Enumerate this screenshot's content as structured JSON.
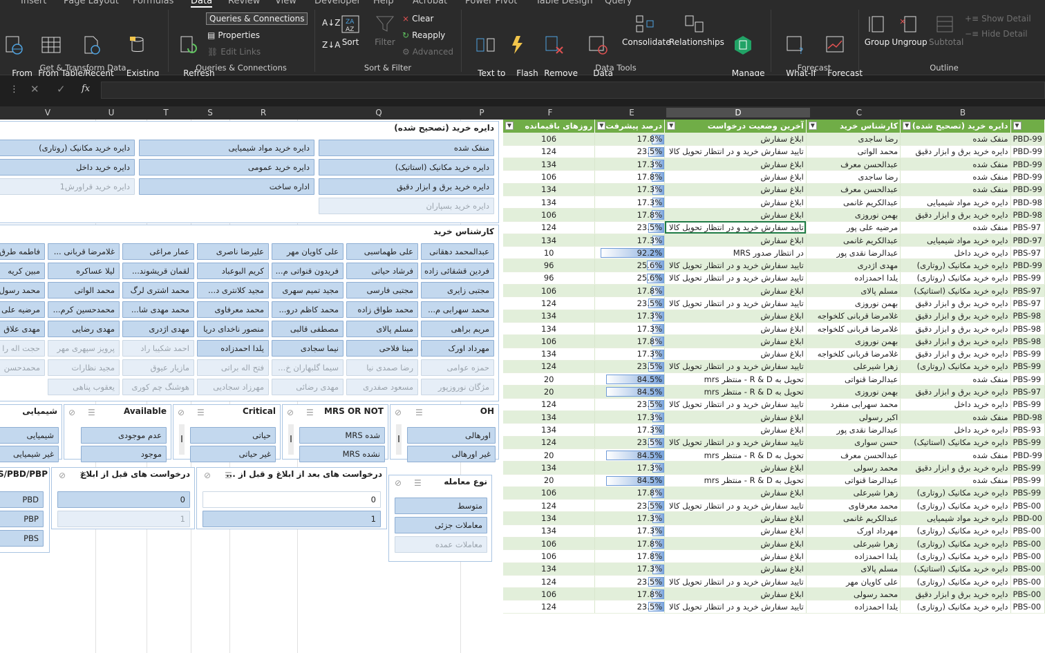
{
  "ribbon_tabs": [
    "Insert",
    "Page Layout",
    "Formulas",
    "Data",
    "Review",
    "View",
    "Developer",
    "Help",
    "Acrobat",
    "Power Pivot",
    "Table Design",
    "Query"
  ],
  "ribbon": {
    "get_transform": {
      "label": "Get & Transform Data",
      "from_web": "From\nWeb",
      "from_table": "From Table/\nRange",
      "recent_sources": "Recent\nSources",
      "existing_connections": "Existing\nConnections"
    },
    "queries": {
      "label": "Queries & Connections",
      "refresh_all": "Refresh\nAll",
      "queries_connections": "Queries & Connections",
      "properties": "Properties",
      "edit_links": "Edit Links"
    },
    "sort_filter": {
      "label": "Sort & Filter",
      "sort": "Sort",
      "filter": "Filter",
      "clear": "Clear",
      "reapply": "Reapply",
      "advanced": "Advanced"
    },
    "data_tools": {
      "label": "Data Tools",
      "text_to_columns": "Text to\nColumns",
      "flash_fill": "Flash\nFill",
      "remove_duplicates": "Remove\nDuplicates",
      "data_validation": "Data\nValidation",
      "consolidate": "Consolidate",
      "relationships": "Relationships",
      "manage_data_model": "Manage\nData Model"
    },
    "forecast": {
      "label": "Forecast",
      "what_if": "What-If\nAnalysis",
      "forecast_sheet": "Forecast\nSheet"
    },
    "outline": {
      "label": "Outline",
      "group": "Group",
      "ungroup": "Ungroup",
      "subtotal": "Subtotal",
      "show_detail": "Show Detail",
      "hide_detail": "Hide Detail"
    }
  },
  "formula_bar": {
    "fx": "fx",
    "value": ""
  },
  "columns_left": [
    "V",
    "U",
    "T",
    "S",
    "R",
    "Q",
    "P"
  ],
  "columns_right": [
    "F",
    "E",
    "D",
    "C",
    "B"
  ],
  "slicers": {
    "dayere": {
      "title": "دایره خرید (تصحیح شده)",
      "items": [
        {
          "label": "منفک شده",
          "on": true
        },
        {
          "label": "دایره خرید مواد شیمیایی",
          "on": true
        },
        {
          "label": "دایره خرید مکانیک (روتاری)",
          "on": true
        },
        {
          "label": "دایره خرید مکانیک (استاتیک)",
          "on": true
        },
        {
          "label": "دایره خرید عمومی",
          "on": true
        },
        {
          "label": "دایره خرید داخل",
          "on": true
        },
        {
          "label": "دایره خرید برق و ابزار دقیق",
          "on": true
        },
        {
          "label": "اداره ساخت",
          "on": true
        },
        {
          "label": "دایره خرید قراورش1",
          "on": false
        },
        {
          "label": "دایره خرید بسپاران",
          "on": false
        }
      ]
    },
    "karshenas": {
      "title": "کارشناس خرید",
      "rows": [
        [
          {
            "label": "عبدالمحمد دهقانی",
            "on": true
          },
          {
            "label": "علی طهماسبی",
            "on": true
          },
          {
            "label": "علی کاویان مهر",
            "on": true
          },
          {
            "label": "علیرضا ناصری",
            "on": true
          },
          {
            "label": "عمار مراغی",
            "on": true
          },
          {
            "label": "غلامرضا قربانی ...",
            "on": true
          },
          {
            "label": "فاطمه طرق",
            "on": true
          }
        ],
        [
          {
            "label": "فردین قشقائی زاده",
            "on": true
          },
          {
            "label": "فرشاد حیاتی",
            "on": true
          },
          {
            "label": "فریدون قنواتی م...",
            "on": true
          },
          {
            "label": "کریم البوعباد",
            "on": true
          },
          {
            "label": "لقمان قریشوند...",
            "on": true
          },
          {
            "label": "لیلا عساکره",
            "on": true
          },
          {
            "label": "مبین کریه",
            "on": true
          }
        ],
        [
          {
            "label": "مجتبی زایری",
            "on": true
          },
          {
            "label": "مجتبی فارسی",
            "on": true
          },
          {
            "label": "مجید تمیم سهری",
            "on": true
          },
          {
            "label": "مجید کلانتری د...",
            "on": true
          },
          {
            "label": "محمد اشتری لرگ",
            "on": true
          },
          {
            "label": "محمد الواتی",
            "on": true
          },
          {
            "label": "محمد رسول",
            "on": true
          }
        ],
        [
          {
            "label": "محمد سهرابی م...",
            "on": true
          },
          {
            "label": "محمد طواق زاده",
            "on": true
          },
          {
            "label": "محمد کاظم درو...",
            "on": true
          },
          {
            "label": "محمد معرفاوی",
            "on": true
          },
          {
            "label": "محمد مهدی شا...",
            "on": true
          },
          {
            "label": "محمدحسین کرم...",
            "on": true
          },
          {
            "label": "مرضیه علی",
            "on": true
          }
        ],
        [
          {
            "label": "مریم براهی",
            "on": true
          },
          {
            "label": "مسلم پالای",
            "on": true
          },
          {
            "label": "مصطفی قالبی",
            "on": true
          },
          {
            "label": "منصور ناخدای دریا",
            "on": true
          },
          {
            "label": "مهدی اژدری",
            "on": true
          },
          {
            "label": "مهدی رضایی",
            "on": true
          },
          {
            "label": "مهدی علاق",
            "on": true
          }
        ],
        [
          {
            "label": "مهرداد اورک",
            "on": true
          },
          {
            "label": "مینا فلاحی",
            "on": true
          },
          {
            "label": "نیما سجادی",
            "on": true
          },
          {
            "label": "یلدا احمدزاده",
            "on": true
          },
          {
            "label": "احمد شکیبا راد",
            "on": false
          },
          {
            "label": "پرویز سپهری مهر",
            "on": false
          },
          {
            "label": "حجت اله را",
            "on": false
          }
        ],
        [
          {
            "label": "حمزه عوامی",
            "on": false
          },
          {
            "label": "رضا صمدی نیا",
            "on": false
          },
          {
            "label": "سیما گلبهاران خ...",
            "on": false
          },
          {
            "label": "فتح اله براتی",
            "on": false
          },
          {
            "label": "مازیار عیوق",
            "on": false
          },
          {
            "label": "مجید نظارات",
            "on": false
          },
          {
            "label": "محمدحسن",
            "on": false
          }
        ],
        [
          {
            "label": "مژگان نوروزپور",
            "on": false
          },
          {
            "label": "مسعود صفدری",
            "on": false
          },
          {
            "label": "مهدی رضائی",
            "on": false
          },
          {
            "label": "مهرزاد سجادیی",
            "on": false
          },
          {
            "label": "هوشنگ چم کوری",
            "on": false
          },
          {
            "label": "یعقوب پناهی",
            "on": false
          }
        ]
      ]
    },
    "oh": {
      "title": "OH",
      "items": [
        "اورهالی",
        "غیر اورهالی"
      ]
    },
    "mrs": {
      "title": "MRS OR NOT",
      "items": [
        "شده MRS",
        "نشده MRS"
      ]
    },
    "critical": {
      "title": "Critical",
      "items": [
        "حیاتی",
        "غیر حیاتی"
      ]
    },
    "available": {
      "title": "Available",
      "items": [
        "عدم موجودی",
        "موجود"
      ]
    },
    "chemical": {
      "title": "شیمیایی",
      "items": [
        "شیمیایی",
        "غیر شیمیایی"
      ]
    },
    "after_notify": {
      "title": "درخواست های بعد از ابلاغ و قبل از ...",
      "items": [
        {
          "label": "0",
          "on": false
        },
        {
          "label": "1",
          "on": true
        }
      ]
    },
    "before_notify": {
      "title": "درخواست های قبل از ابلاغ",
      "items": [
        {
          "label": "0",
          "on": true
        },
        {
          "label": "1",
          "on": false
        }
      ]
    },
    "pbs": {
      "title": "S/PBD/PBP",
      "items": [
        "PBD",
        "PBP",
        "PBS"
      ]
    },
    "deal_type": {
      "title": "نوع معامله",
      "items": [
        {
          "label": "متوسط",
          "on": true
        },
        {
          "label": "معاملات جزئی",
          "on": true
        },
        {
          "label": "معاملات عمده",
          "on": false
        }
      ]
    }
  },
  "table": {
    "headers": {
      "f": "روزهای باقیمانده",
      "e": "درصد پیشرفت",
      "d": "آخرین وضعیت درخواست",
      "c": "کارشناس خرید",
      "b": "دایره خرید (تصحیح شده)",
      "a": ""
    },
    "rows": [
      {
        "f": "106",
        "e": "17.8%",
        "p": 17.8,
        "d": "ابلاغ سفارش",
        "c": "رضا ساجدی",
        "b": "منفک شده",
        "a": "PBD-99"
      },
      {
        "f": "124",
        "e": "23.5%",
        "p": 23.5,
        "d": "تایید سفارش خرید و در انتظار تحویل کالا",
        "c": "محمد الواتی",
        "b": "دایره خرید برق و ابزار دقیق",
        "a": "PBD-99"
      },
      {
        "f": "134",
        "e": "17.3%",
        "p": 17.3,
        "d": "ابلاغ سفارش",
        "c": "عبدالحسن معرف",
        "b": "منفک شده",
        "a": "PBD-99"
      },
      {
        "f": "106",
        "e": "17.8%",
        "p": 17.8,
        "d": "ابلاغ سفارش",
        "c": "رضا ساجدی",
        "b": "منفک شده",
        "a": "PBD-99"
      },
      {
        "f": "134",
        "e": "17.3%",
        "p": 17.3,
        "d": "ابلاغ سفارش",
        "c": "عبدالحسن معرف",
        "b": "منفک شده",
        "a": "PBD-99"
      },
      {
        "f": "134",
        "e": "17.3%",
        "p": 17.3,
        "d": "ابلاغ سفارش",
        "c": "عبدالکریم غانمی",
        "b": "دایره خرید مواد شیمیایی",
        "a": "PBD-98"
      },
      {
        "f": "106",
        "e": "17.8%",
        "p": 17.8,
        "d": "ابلاغ سفارش",
        "c": "بهمن نوروزی",
        "b": "دایره خرید برق و ابزار دقیق",
        "a": "PBD-98"
      },
      {
        "f": "124",
        "e": "23.5%",
        "p": 23.5,
        "d": "تایید سفارش خرید و در انتظار تحویل کالا",
        "c": "مرضیه علی پور",
        "b": "منفک شده",
        "a": "PBS-97"
      },
      {
        "f": "134",
        "e": "17.3%",
        "p": 17.3,
        "d": "ابلاغ سفارش",
        "c": "عبدالکریم غانمی",
        "b": "دایره خرید مواد شیمیایی",
        "a": "PBD-97"
      },
      {
        "f": "10",
        "e": "92.2%",
        "p": 92.2,
        "d": "در انتظار صدور MRS",
        "c": "عبدالرضا نقدی پور",
        "b": "دایره خرید داخل",
        "a": "PBS-97"
      },
      {
        "f": "96",
        "e": "25.6%",
        "p": 25.6,
        "d": "تایید سفارش خرید و در انتظار تحویل کالا",
        "c": "مهدی اژدری",
        "b": "دایره خرید مکانیک (روتاری)",
        "a": "PBD-99"
      },
      {
        "f": "96",
        "e": "25.6%",
        "p": 25.6,
        "d": "تایید سفارش خرید و در انتظار تحویل کالا",
        "c": "یلدا احمدزاده",
        "b": "دایره خرید مکانیک (روتاری)",
        "a": "PBS-99"
      },
      {
        "f": "106",
        "e": "17.8%",
        "p": 17.8,
        "d": "ابلاغ سفارش",
        "c": "مسلم پالای",
        "b": "دایره خرید مکانیک (استاتیک)",
        "a": "PBS-97"
      },
      {
        "f": "124",
        "e": "23.5%",
        "p": 23.5,
        "d": "تایید سفارش خرید و در انتظار تحویل کالا",
        "c": "بهمن نوروزی",
        "b": "دایره خرید برق و ابزار دقیق",
        "a": "PBS-97"
      },
      {
        "f": "134",
        "e": "17.3%",
        "p": 17.3,
        "d": "ابلاغ سفارش",
        "c": "غلامرضا قربانی کلخواجه",
        "b": "دایره خرید برق و ابزار دقیق",
        "a": "PBS-98"
      },
      {
        "f": "134",
        "e": "17.3%",
        "p": 17.3,
        "d": "ابلاغ سفارش",
        "c": "غلامرضا قربانی کلخواجه",
        "b": "دایره خرید برق و ابزار دقیق",
        "a": "PBS-98"
      },
      {
        "f": "106",
        "e": "17.8%",
        "p": 17.8,
        "d": "ابلاغ سفارش",
        "c": "بهمن نوروزی",
        "b": "دایره خرید برق و ابزار دقیق",
        "a": "PBS-98"
      },
      {
        "f": "134",
        "e": "17.3%",
        "p": 17.3,
        "d": "ابلاغ سفارش",
        "c": "غلامرضا قربانی کلخواجه",
        "b": "دایره خرید برق و ابزار دقیق",
        "a": "PBS-99"
      },
      {
        "f": "124",
        "e": "23.5%",
        "p": 23.5,
        "d": "تایید سفارش خرید و در انتظار تحویل کالا",
        "c": "زهرا شیرعلی",
        "b": "دایره خرید مکانیک (روتاری)",
        "a": "PBS-99"
      },
      {
        "f": "20",
        "e": "84.5%",
        "p": 84.5,
        "d": "تحویل به R & D - منتظر mrs",
        "c": "عبدالرضا قنواتی",
        "b": "منفک شده",
        "a": "PBS-99"
      },
      {
        "f": "20",
        "e": "84.5%",
        "p": 84.5,
        "d": "تحویل به R & D - منتظر mrs",
        "c": "بهمن نوروزی",
        "b": "دایره خرید برق و ابزار دقیق",
        "a": "PBS-97"
      },
      {
        "f": "124",
        "e": "23.5%",
        "p": 23.5,
        "d": "تایید سفارش خرید و در انتظار تحویل کالا",
        "c": "محمد سهرابی منفرد",
        "b": "دایره خرید داخل",
        "a": "PBS-99"
      },
      {
        "f": "134",
        "e": "17.3%",
        "p": 17.3,
        "d": "ابلاغ سفارش",
        "c": "اکبر رسولی",
        "b": "منفک شده",
        "a": "PBD-98"
      },
      {
        "f": "134",
        "e": "17.3%",
        "p": 17.3,
        "d": "ابلاغ سفارش",
        "c": "عبدالرضا نقدی پور",
        "b": "دایره خرید داخل",
        "a": "PBS-93"
      },
      {
        "f": "124",
        "e": "23.5%",
        "p": 23.5,
        "d": "تایید سفارش خرید و در انتظار تحویل کالا",
        "c": "حسن سواری",
        "b": "دایره خرید مکانیک (استاتیک)",
        "a": "PBS-99"
      },
      {
        "f": "20",
        "e": "84.5%",
        "p": 84.5,
        "d": "تحویل به R & D - منتظر mrs",
        "c": "عبدالحسن معرف",
        "b": "منفک شده",
        "a": "PBD-99"
      },
      {
        "f": "134",
        "e": "17.3%",
        "p": 17.3,
        "d": "ابلاغ سفارش",
        "c": "محمد رسولی",
        "b": "دایره خرید برق و ابزار دقیق",
        "a": "PBS-99"
      },
      {
        "f": "20",
        "e": "84.5%",
        "p": 84.5,
        "d": "تحویل به R & D - منتظر mrs",
        "c": "عبدالرضا قنواتی",
        "b": "منفک شده",
        "a": "PBS-99"
      },
      {
        "f": "106",
        "e": "17.8%",
        "p": 17.8,
        "d": "ابلاغ سفارش",
        "c": "زهرا شیرعلی",
        "b": "دایره خرید مکانیک (روتاری)",
        "a": "PBS-99"
      },
      {
        "f": "124",
        "e": "23.5%",
        "p": 23.5,
        "d": "تایید سفارش خرید و در انتظار تحویل کالا",
        "c": "محمد معرفاوی",
        "b": "دایره خرید مکانیک (روتاری)",
        "a": "PBS-00"
      },
      {
        "f": "134",
        "e": "17.3%",
        "p": 17.3,
        "d": "ابلاغ سفارش",
        "c": "عبدالکریم غانمی",
        "b": "دایره خرید مواد شیمیایی",
        "a": "PBD-00"
      },
      {
        "f": "134",
        "e": "17.3%",
        "p": 17.3,
        "d": "ابلاغ سفارش",
        "c": "مهرداد اورک",
        "b": "دایره خرید مکانیک (روتاری)",
        "a": "PBS-00"
      },
      {
        "f": "106",
        "e": "17.8%",
        "p": 17.8,
        "d": "ابلاغ سفارش",
        "c": "زهرا شیرعلی",
        "b": "دایره خرید مکانیک (روتاری)",
        "a": "PBS-00"
      },
      {
        "f": "106",
        "e": "17.8%",
        "p": 17.8,
        "d": "ابلاغ سفارش",
        "c": "یلدا احمدزاده",
        "b": "دایره خرید مکانیک (روتاری)",
        "a": "PBS-00"
      },
      {
        "f": "134",
        "e": "17.3%",
        "p": 17.3,
        "d": "ابلاغ سفارش",
        "c": "مسلم پالای",
        "b": "دایره خرید مکانیک (استاتیک)",
        "a": "PBS-00"
      },
      {
        "f": "124",
        "e": "23.5%",
        "p": 23.5,
        "d": "تایید سفارش خرید و در انتظار تحویل کالا",
        "c": "علی کاویان مهر",
        "b": "دایره خرید مکانیک (روتاری)",
        "a": "PBS-00"
      },
      {
        "f": "106",
        "e": "17.8%",
        "p": 17.8,
        "d": "ابلاغ سفارش",
        "c": "محمد رسولی",
        "b": "دایره خرید برق و ابزار دقیق",
        "a": "PBS-00"
      },
      {
        "f": "124",
        "e": "23.5%",
        "p": 23.5,
        "d": "تایید سفارش خرید و در انتظار تحویل کالا",
        "c": "یلدا احمدزاده",
        "b": "دایره خرید مکانیک (روتاری)",
        "a": "PBS-00"
      }
    ]
  },
  "colors": {
    "table_header": "#70ad47",
    "band": "#e2efda",
    "slicer_on": "#c3d8ee",
    "slicer_off": "#e6eef7"
  }
}
